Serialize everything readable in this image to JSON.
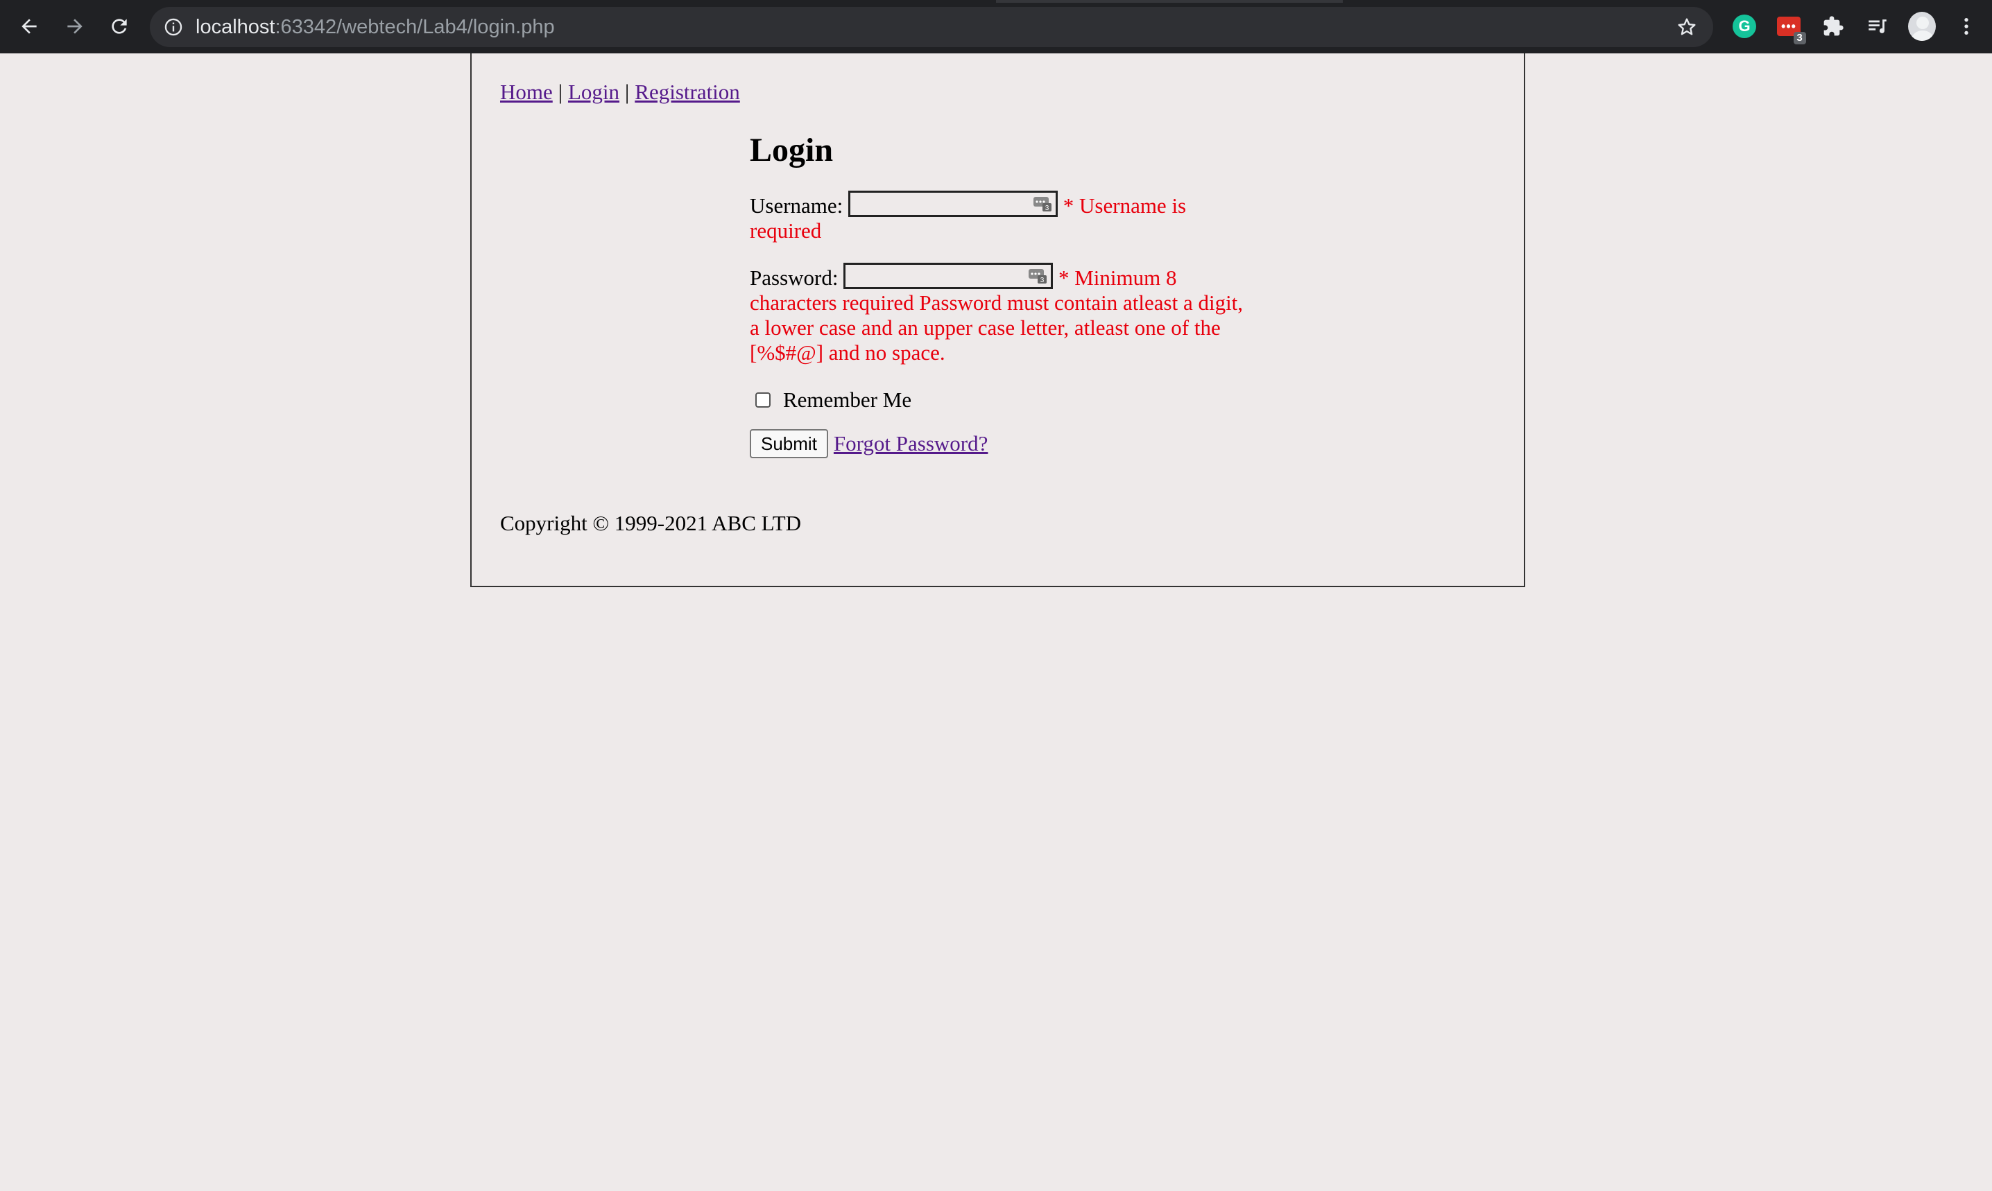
{
  "browser": {
    "url_host": "localhost",
    "url_rest": ":63342/webtech/Lab4/login.php",
    "extension_badge_count": "3",
    "grammarly_letter": "G",
    "password_ext_label": "•••"
  },
  "nav": {
    "links": [
      "Home",
      "Login",
      "Registration"
    ],
    "separator": "|"
  },
  "form": {
    "title": "Login",
    "username_label": "Username:",
    "username_value": "",
    "username_error": "* Username is required",
    "password_label": "Password:",
    "password_value": "",
    "password_error": "* Minimum 8 characters required Password must contain atleast a digit, a lower case and an upper case letter, atleast one of the [%$#@] and no space.",
    "remember_label": "Remember Me",
    "remember_checked": false,
    "submit_label": "Submit",
    "forgot_label": "Forgot Password?",
    "field_badge_count": "3"
  },
  "footer": {
    "copyright": "Copyright © 1999-2021 ABC LTD"
  },
  "colors": {
    "page_bg": "#eeeaea",
    "error": "#e8000d",
    "link": "#551a8b",
    "chrome_bg": "#202124"
  }
}
